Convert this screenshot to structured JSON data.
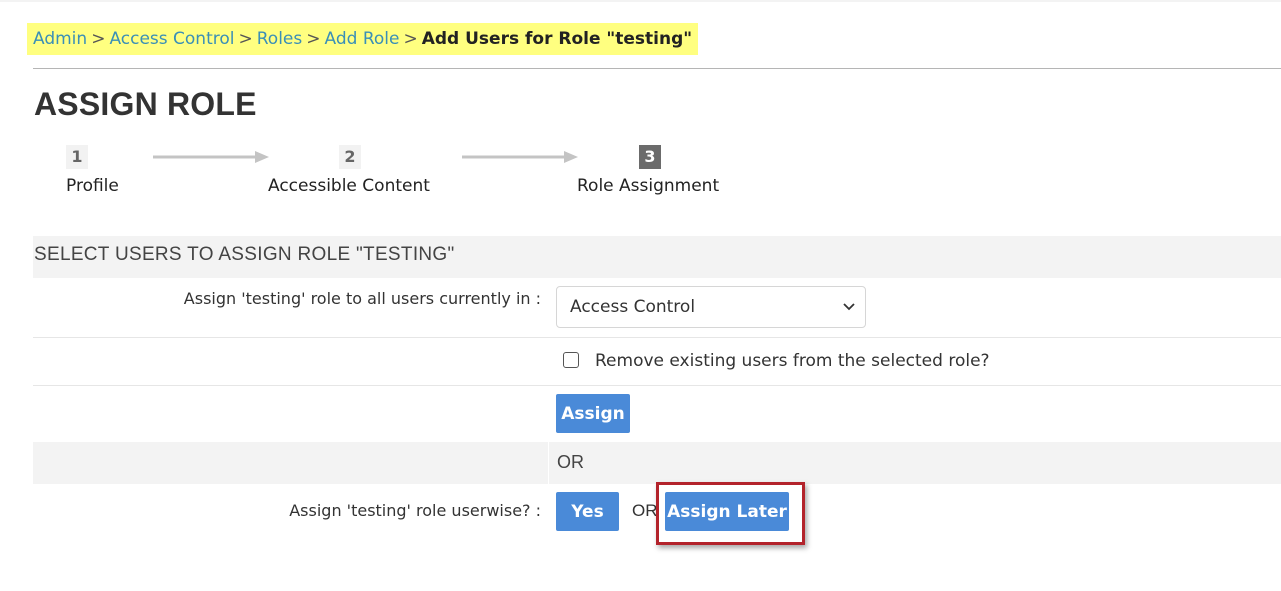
{
  "breadcrumb": {
    "items": [
      "Admin",
      "Access Control",
      "Roles",
      "Add Role"
    ],
    "separator": ">",
    "current": "Add Users for Role \"testing\""
  },
  "page": {
    "title": "ASSIGN ROLE"
  },
  "steps": [
    {
      "number": "1",
      "label": "Profile"
    },
    {
      "number": "2",
      "label": "Accessible Content"
    },
    {
      "number": "3",
      "label": "Role Assignment"
    }
  ],
  "section": {
    "title": "SELECT USERS TO ASSIGN ROLE \"TESTING\""
  },
  "form": {
    "assign_all_label": "Assign 'testing' role to all users currently in :",
    "group_select_value": "Access Control",
    "remove_existing_label": "Remove existing users from the selected role?",
    "remove_existing_checked": false,
    "assign_button": "Assign",
    "or_text": "OR",
    "userwise_label": "Assign 'testing' role userwise? :",
    "yes_button": "Yes",
    "or_inline": "OR",
    "assign_later_button": "Assign Later"
  },
  "colors": {
    "breadcrumb_highlight": "#ffff80",
    "link": "#3a8fb7",
    "button": "#4a8ad8",
    "highlight_border": "#b3232b",
    "active_step": "#6b6b6b"
  }
}
